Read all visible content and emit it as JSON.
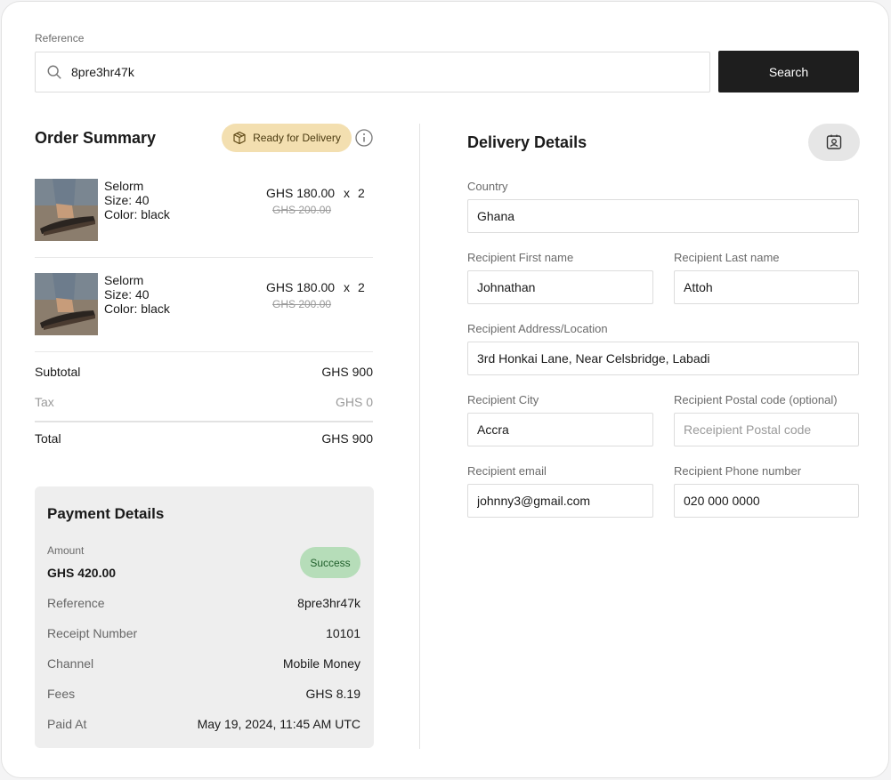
{
  "search": {
    "label": "Reference",
    "value": "8pre3hr47k",
    "button": "Search"
  },
  "order_summary": {
    "title": "Order Summary",
    "status_badge": "Ready for Delivery",
    "items": [
      {
        "name": "Selorm",
        "size_label": "Size:",
        "size": "40",
        "color_label": "Color:",
        "color": "black",
        "price": "GHS 180.00",
        "times": "x",
        "qty": "2",
        "old_price": "GHS 200.00"
      },
      {
        "name": "Selorm",
        "size_label": "Size:",
        "size": "40",
        "color_label": "Color:",
        "color": "black",
        "price": "GHS 180.00",
        "times": "x",
        "qty": "2",
        "old_price": "GHS 200.00"
      }
    ],
    "subtotal_label": "Subtotal",
    "subtotal": "GHS 900",
    "tax_label": "Tax",
    "tax": "GHS 0",
    "total_label": "Total",
    "total": "GHS 900"
  },
  "payment": {
    "title": "Payment Details",
    "amount_label": "Amount",
    "amount": "GHS 420.00",
    "status": "Success",
    "rows": [
      {
        "k": "Reference",
        "v": "8pre3hr47k"
      },
      {
        "k": "Receipt Number",
        "v": "10101"
      },
      {
        "k": "Channel",
        "v": "Mobile Money"
      },
      {
        "k": "Fees",
        "v": "GHS 8.19"
      },
      {
        "k": "Paid At",
        "v": "May 19, 2024, 11:45 AM UTC"
      }
    ]
  },
  "delivery": {
    "title": "Delivery Details",
    "country_label": "Country",
    "country": "Ghana",
    "first_name_label": "Recipient First name",
    "first_name": "Johnathan",
    "last_name_label": "Recipient Last name",
    "last_name": "Attoh",
    "address_label": "Recipient Address/Location",
    "address": "3rd Honkai Lane, Near Celsbridge, Labadi",
    "city_label": "Recipient City",
    "city": "Accra",
    "postal_label": "Recipient Postal code (optional)",
    "postal_placeholder": "Receipient Postal code",
    "email_label": "Recipient email",
    "email": "johnny3@gmail.com",
    "phone_label": "Recipient Phone number",
    "phone": "020 000 0000"
  },
  "colors": {
    "badge_bg": "#f3dfb0",
    "success_bg": "#b6ddb9",
    "button_bg": "#1e1e1e"
  }
}
